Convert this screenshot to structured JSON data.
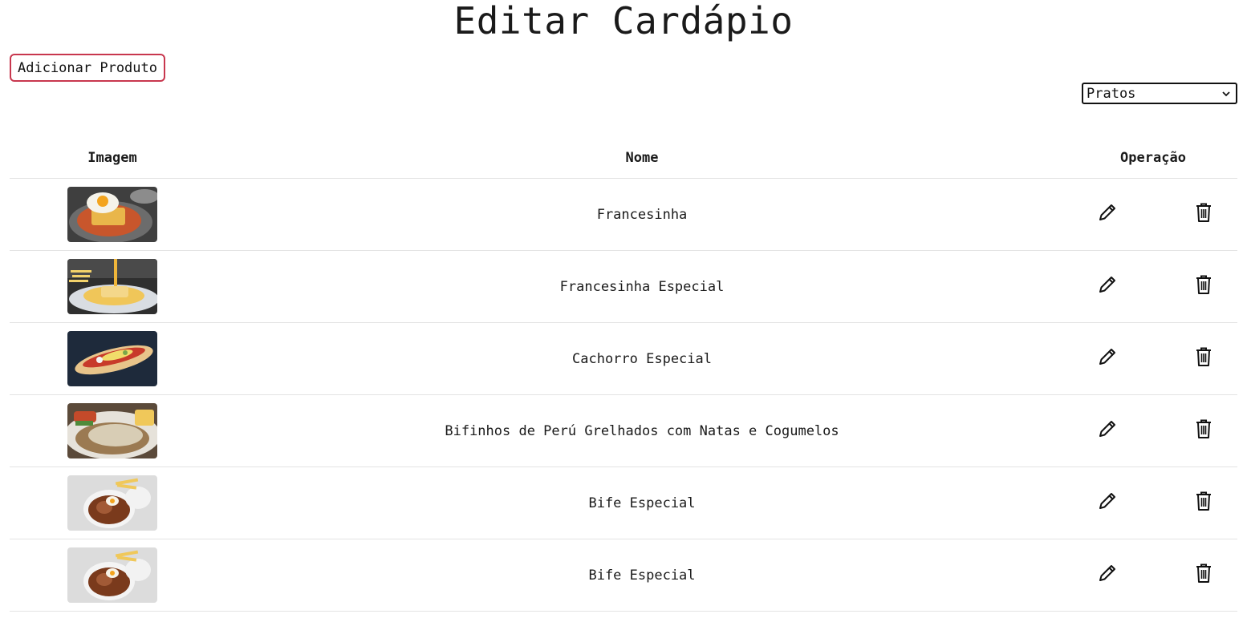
{
  "page": {
    "title": "Editar Cardápio"
  },
  "toolbar": {
    "add_label": "Adicionar Produto",
    "category_selected": "Pratos"
  },
  "table": {
    "headers": {
      "image": "Imagem",
      "name": "Nome",
      "operation": "Operação"
    },
    "rows": [
      {
        "name": "Francesinha",
        "image_icon": "francesinha-photo"
      },
      {
        "name": "Francesinha Especial",
        "image_icon": "francesinha-especial-photo"
      },
      {
        "name": "Cachorro Especial",
        "image_icon": "cachorro-especial-photo"
      },
      {
        "name": "Bifinhos de Perú Grelhados com Natas e Cogumelos",
        "image_icon": "bifinhos-photo"
      },
      {
        "name": "Bife Especial",
        "image_icon": "bife-especial-photo"
      },
      {
        "name": "Bife Especial",
        "image_icon": "bife-especial-photo"
      }
    ]
  },
  "icons": {
    "edit": "pencil-icon",
    "delete": "trash-icon",
    "select": "chevron-down-icon"
  },
  "colors": {
    "add_button_border": "#c8374e",
    "row_divider": "#e3e3e3",
    "text": "#1a1a1a"
  }
}
